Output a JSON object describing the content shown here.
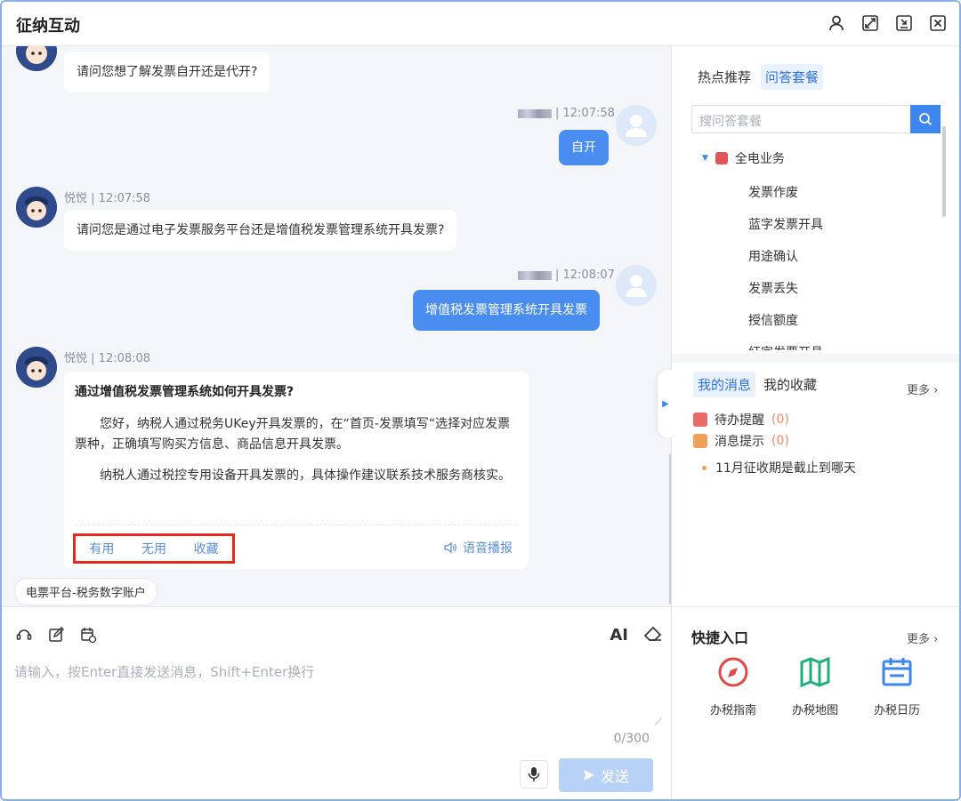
{
  "app": {
    "title": "征纳互动"
  },
  "chat": {
    "messages": [
      {
        "from": "bot",
        "text": "请问您想了解发票自开还是代开?"
      },
      {
        "from": "user",
        "time": "| 12:07:58",
        "text": "自开"
      },
      {
        "from": "bot",
        "sender": "悦悦",
        "time": "| 12:07:58",
        "text": "请问您是通过电子发票服务平台还是增值税发票管理系统开具发票?"
      },
      {
        "from": "user",
        "time": "| 12:08:07",
        "text": "增值税发票管理系统开具发票"
      },
      {
        "from": "bot",
        "sender": "悦悦",
        "time": "| 12:08:08"
      }
    ],
    "answer": {
      "question": "通过增值税发票管理系统如何开具发票?",
      "para1": "您好，纳税人通过税务UKey开具发票的，在“首页-发票填写“选择对应发票票种，正确填写购买方信息、商品信息开具发票。",
      "para2": "纳税人通过税控专用设备开具发票的，具体操作建议联系技术服务商核实。",
      "useful": "有用",
      "useless": "无用",
      "favorite": "收藏",
      "voice": "语音播报"
    },
    "chip": "电票平台-税务数字账户"
  },
  "input": {
    "ai_label": "AI",
    "placeholder": "请输入，按Enter直接发送消息，Shift+Enter换行",
    "count": "0/300",
    "send": "发送"
  },
  "right": {
    "tabs": [
      "热点推荐",
      "问答套餐"
    ],
    "search_placeholder": "搜问答套餐",
    "tree_root": "全电业务",
    "tree_items": [
      "发票作废",
      "蓝字发票开具",
      "用途确认",
      "发票丢失",
      "授信额度",
      "红字发票开具"
    ],
    "msg_tabs": [
      "我的消息",
      "我的收藏"
    ],
    "more": "更多",
    "todo_label": "待办提醒",
    "todo_count": "(0)",
    "notice_label": "消息提示",
    "notice_count": "(0)",
    "bullet": "11月征收期是截止到哪天",
    "quick_title": "快捷入口",
    "quick_items": [
      "办税指南",
      "办税地图",
      "办税日历"
    ]
  },
  "colors": {
    "accent": "#3e86ef",
    "user_bubble": "#4a8df0",
    "highlight_box": "#e32a1e"
  }
}
